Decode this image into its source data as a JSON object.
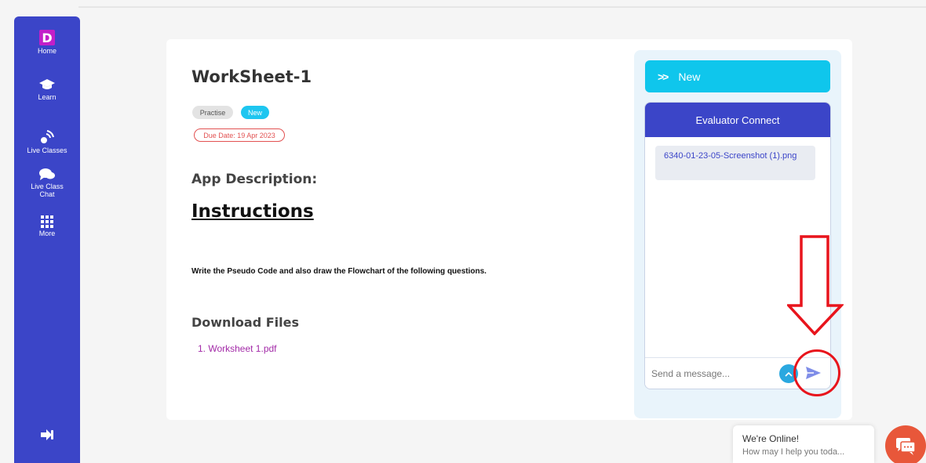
{
  "sidebar": {
    "logo_letter": "D",
    "items": [
      {
        "label": "Home",
        "icon": "logo-d"
      },
      {
        "label": "Learn",
        "icon": "graduation-cap-icon"
      },
      {
        "label": "Live Classes",
        "icon": "broadcast-icon"
      },
      {
        "label": "Live Class Chat",
        "icon": "chat-bubbles-icon"
      },
      {
        "label": "More",
        "icon": "grid-icon"
      }
    ],
    "logout_icon": "logout-icon"
  },
  "worksheet": {
    "title": "WorkSheet-1",
    "tags": [
      "Practise",
      "New"
    ],
    "due_date": "Due Date: 19 Apr 2023",
    "app_description_heading": "App Description:",
    "instructions_heading": "Instructions",
    "instructions_text": "Write the Pseudo Code and also draw the Flowchart of the following questions.",
    "download_heading": "Download Files",
    "files": [
      "1. Worksheet 1.pdf"
    ]
  },
  "chat": {
    "new_button_label": "New",
    "header": "Evaluator Connect",
    "messages": [
      "6340-01-23-05-Screenshot (1).png"
    ],
    "input_placeholder": "Send a message..."
  },
  "online_widget": {
    "title": "We're Online!",
    "subtitle": "How may I help you toda..."
  },
  "colors": {
    "sidebar": "#3b45c8",
    "accent_cyan": "#0fc6ec",
    "annotation_red": "#e8141c",
    "link_purple": "#a32ba8"
  }
}
